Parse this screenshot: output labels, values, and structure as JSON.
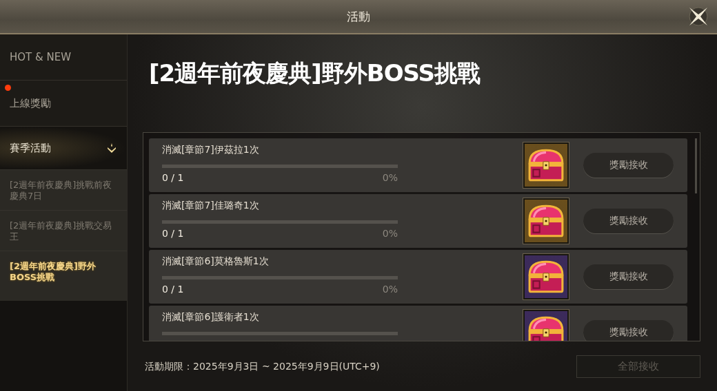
{
  "window": {
    "title": "活動"
  },
  "sidebar": {
    "items": [
      {
        "label": "HOT & NEW",
        "selected": false
      },
      {
        "label": "上線獎勵",
        "selected": false,
        "notification": true
      },
      {
        "label": "賽季活動",
        "selected": true,
        "expanded": true,
        "children": [
          {
            "label": "[2週年前夜慶典]挑戰前夜慶典7日",
            "selected": false
          },
          {
            "label": "[2週年前夜慶典]挑戰交易王",
            "selected": false
          },
          {
            "label": "[2週年前夜慶典]野外BOSS挑戰",
            "selected": true
          }
        ]
      }
    ]
  },
  "event": {
    "title": "[2週年前夜慶典]野外BOSS挑戰",
    "missions": [
      {
        "name": "消滅[章節7]伊茲拉1次",
        "level": 0,
        "progress": "0 / 1",
        "percent": "0%",
        "color": "#6b4f1c",
        "button": "獎勵接收"
      },
      {
        "name": "消滅[章節7]佳璐奇1次",
        "level": 0,
        "progress": "0 / 1",
        "percent": "0%",
        "color": "#6b4f1c",
        "button": "獎勵接收"
      },
      {
        "name": "消滅[章節6]莫格魯斯1次",
        "level": 0,
        "progress": "0 / 1",
        "percent": "0%",
        "color": "#3c2a5c",
        "button": "獎勵接收"
      },
      {
        "name": "消滅[章節6]護衛者1次",
        "level": 0,
        "color": "#3c2a5c",
        "button": "獎勵接收"
      }
    ],
    "period": "活動期限：2025年9月3日 ~ 2025年9月9日(UTC+9)",
    "claim_all": {
      "label": "全部接收",
      "disabled": true
    }
  }
}
